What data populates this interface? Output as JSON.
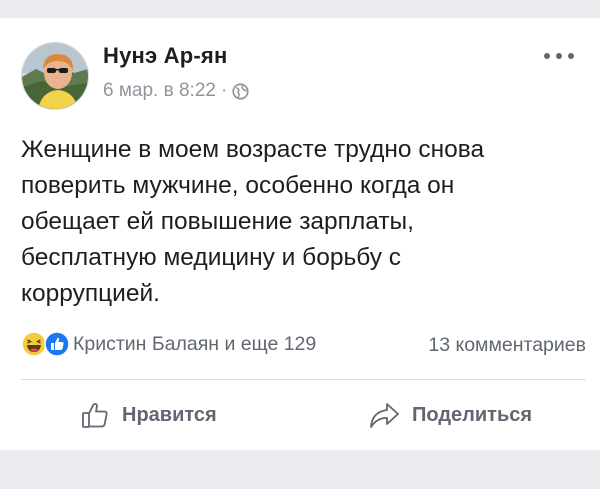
{
  "post": {
    "author": "Нунэ Ар-ян",
    "timestamp": "6 мар. в 8:22",
    "separator": "·",
    "privacy_icon": "globe-icon",
    "text": "Женщине в моем возрасте   трудно снова\nповерить мужчине, особенно когда он\nобещает ей повышение зарплаты,\nбесплатную медицину и борьбу с\nкоррупцией.",
    "reactions": {
      "icons": [
        "haha-icon",
        "like-icon"
      ],
      "summary": "Кристин Балаян и еще 129"
    },
    "comments_count": "13 комментариев",
    "actions": {
      "like_label": "Нравится",
      "share_label": "Поделиться"
    }
  },
  "colors": {
    "background": "#e9ebee",
    "card": "#ffffff",
    "secondary_text": "#606770",
    "meta_text": "#90949c",
    "like_blue": "#1877f2",
    "haha_yellow": "#f7c93c"
  }
}
